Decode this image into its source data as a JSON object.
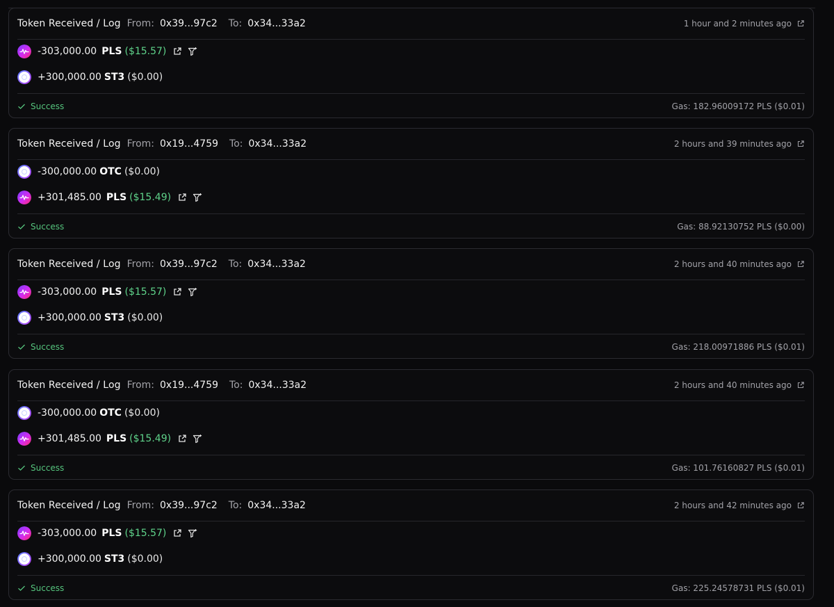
{
  "colors": {
    "success": "#55c47d",
    "usd_positive": "#5fd38a",
    "pls_gradient": [
      "#8a2be2",
      "#ff2a6d"
    ]
  },
  "icons": {
    "external_link": "external-link-icon",
    "filter": "filter-icon",
    "status": "check-icon"
  },
  "transactions": [
    {
      "title": "Token Received / Log",
      "from_label": "From:",
      "from": "0x39...97c2",
      "to_label": "To:",
      "to": "0x34...33a2",
      "time": "1 hour and 2 minutes ago",
      "rows": [
        {
          "amount": "-303,000.00",
          "symbol": "PLS",
          "usd": "($15.57)"
        },
        {
          "amount": "+300,000.00",
          "symbol": "ST3",
          "usd": "($0.00)"
        }
      ],
      "status": "Success",
      "gas": "Gas: 182.96009172 PLS ($0.01)"
    },
    {
      "title": "Token Received / Log",
      "from_label": "From:",
      "from": "0x19...4759",
      "to_label": "To:",
      "to": "0x34...33a2",
      "time": "2 hours and 39 minutes ago",
      "rows": [
        {
          "amount": "-300,000.00",
          "symbol": "OTC",
          "usd": "($0.00)"
        },
        {
          "amount": "+301,485.00",
          "symbol": "PLS",
          "usd": "($15.49)"
        }
      ],
      "status": "Success",
      "gas": "Gas: 88.92130752 PLS ($0.00)"
    },
    {
      "title": "Token Received / Log",
      "from_label": "From:",
      "from": "0x39...97c2",
      "to_label": "To:",
      "to": "0x34...33a2",
      "time": "2 hours and 40 minutes ago",
      "rows": [
        {
          "amount": "-303,000.00",
          "symbol": "PLS",
          "usd": "($15.57)"
        },
        {
          "amount": "+300,000.00",
          "symbol": "ST3",
          "usd": "($0.00)"
        }
      ],
      "status": "Success",
      "gas": "Gas: 218.00971886 PLS ($0.01)"
    },
    {
      "title": "Token Received / Log",
      "from_label": "From:",
      "from": "0x19...4759",
      "to_label": "To:",
      "to": "0x34...33a2",
      "time": "2 hours and 40 minutes ago",
      "rows": [
        {
          "amount": "-300,000.00",
          "symbol": "OTC",
          "usd": "($0.00)"
        },
        {
          "amount": "+301,485.00",
          "symbol": "PLS",
          "usd": "($15.49)"
        }
      ],
      "status": "Success",
      "gas": "Gas: 101.76160827 PLS ($0.01)"
    },
    {
      "title": "Token Received / Log",
      "from_label": "From:",
      "from": "0x39...97c2",
      "to_label": "To:",
      "to": "0x34...33a2",
      "time": "2 hours and 42 minutes ago",
      "rows": [
        {
          "amount": "-303,000.00",
          "symbol": "PLS",
          "usd": "($15.57)"
        },
        {
          "amount": "+300,000.00",
          "symbol": "ST3",
          "usd": "($0.00)"
        }
      ],
      "status": "Success",
      "gas": "Gas: 225.24578731 PLS ($0.01)"
    }
  ]
}
